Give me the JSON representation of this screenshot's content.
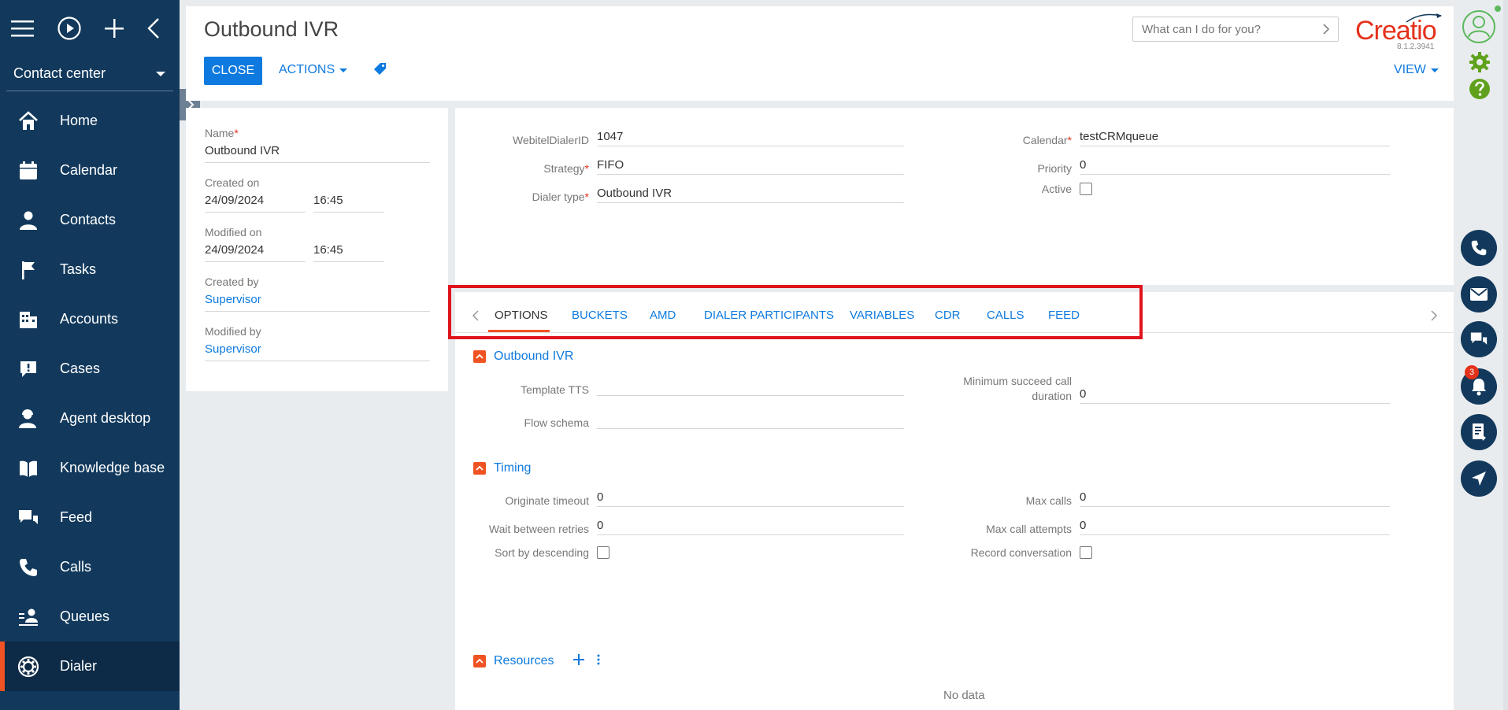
{
  "workspace": "Contact center",
  "nav": [
    {
      "label": "Home",
      "icon": "home-icon"
    },
    {
      "label": "Calendar",
      "icon": "calendar-icon"
    },
    {
      "label": "Contacts",
      "icon": "contact-icon"
    },
    {
      "label": "Tasks",
      "icon": "flag-icon"
    },
    {
      "label": "Accounts",
      "icon": "building-icon"
    },
    {
      "label": "Cases",
      "icon": "alert-bubble-icon"
    },
    {
      "label": "Agent desktop",
      "icon": "agent-icon"
    },
    {
      "label": "Knowledge base",
      "icon": "book-icon"
    },
    {
      "label": "Feed",
      "icon": "feed-icon"
    },
    {
      "label": "Calls",
      "icon": "phone-icon"
    },
    {
      "label": "Queues",
      "icon": "queue-icon"
    },
    {
      "label": "Dialer",
      "icon": "dialer-icon"
    }
  ],
  "active_nav": "Dialer",
  "header": {
    "title": "Outbound IVR",
    "close_label": "CLOSE",
    "actions_label": "ACTIONS",
    "view_label": "VIEW",
    "search_placeholder": "What can I do for you?",
    "logo": "Creatio",
    "version": "8.1.2.3941"
  },
  "left_panel": {
    "name_label": "Name",
    "name_value": "Outbound IVR",
    "created_on_label": "Created on",
    "created_on_date": "24/09/2024",
    "created_on_time": "16:45",
    "modified_on_label": "Modified on",
    "modified_on_date": "24/09/2024",
    "modified_on_time": "16:45",
    "created_by_label": "Created by",
    "created_by_value": "Supervisor",
    "modified_by_label": "Modified by",
    "modified_by_value": "Supervisor"
  },
  "main_fields": {
    "webitel_label": "WebitelDialerID",
    "webitel_value": "1047",
    "strategy_label": "Strategy",
    "strategy_value": "FIFO",
    "dialer_type_label": "Dialer type",
    "dialer_type_value": "Outbound IVR",
    "calendar_label": "Calendar",
    "calendar_value": "testCRMqueue",
    "priority_label": "Priority",
    "priority_value": "0",
    "active_label": "Active",
    "active_checked": false
  },
  "tabs": [
    "OPTIONS",
    "BUCKETS",
    "AMD",
    "DIALER PARTICIPANTS",
    "VARIABLES",
    "CDR",
    "CALLS",
    "FEED"
  ],
  "active_tab": "OPTIONS",
  "options": {
    "section1_title": "Outbound IVR",
    "template_tts_label": "Template TTS",
    "template_tts_value": "",
    "flow_schema_label": "Flow schema",
    "flow_schema_value": "",
    "min_succeed_label": "Minimum succeed call duration",
    "min_succeed_value": "0",
    "section2_title": "Timing",
    "originate_timeout_label": "Originate timeout",
    "originate_timeout_value": "0",
    "wait_retries_label": "Wait between retries",
    "wait_retries_value": "0",
    "sort_desc_label": "Sort by descending",
    "max_calls_label": "Max calls",
    "max_calls_value": "0",
    "max_attempts_label": "Max call attempts",
    "max_attempts_value": "0",
    "record_label": "Record conversation",
    "section3_title": "Resources",
    "no_data": "No data"
  },
  "notifications_count": "3",
  "colors": {
    "sidebar": "#12395c",
    "accent": "#f05323",
    "primary": "#0e7adf",
    "highlight": "#e0141e"
  }
}
